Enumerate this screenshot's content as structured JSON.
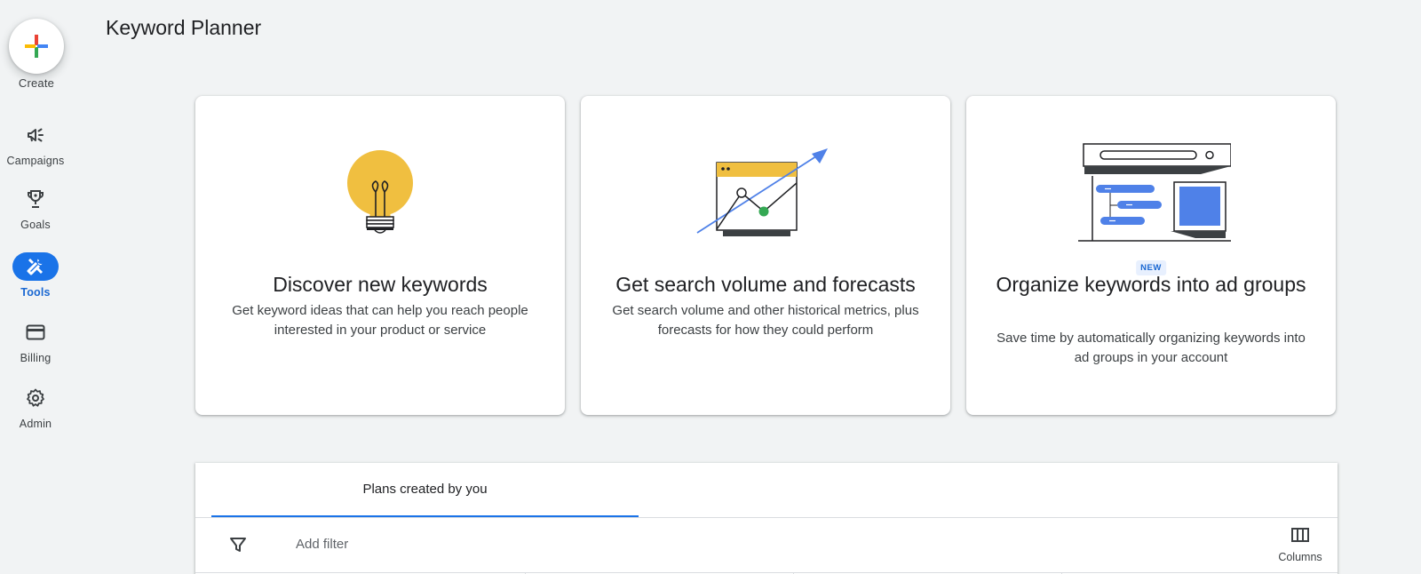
{
  "rail": {
    "create_label": "Create",
    "items": [
      {
        "label": "Campaigns",
        "icon": "megaphone-icon"
      },
      {
        "label": "Goals",
        "icon": "trophy-icon"
      },
      {
        "label": "Tools",
        "icon": "tools-icon",
        "active": true
      },
      {
        "label": "Billing",
        "icon": "credit-card-icon"
      },
      {
        "label": "Admin",
        "icon": "gear-icon"
      }
    ]
  },
  "page": {
    "title": "Keyword Planner"
  },
  "cards": [
    {
      "title": "Discover new keywords",
      "description": "Get keyword ideas that can help you reach people interested in your product or service",
      "illustration": "lightbulb-illustration"
    },
    {
      "title": "Get search volume and forecasts",
      "description": "Get search volume and other historical metrics, plus forecasts for how they could perform",
      "illustration": "chart-trend-illustration"
    },
    {
      "title": "Organize keywords into ad groups",
      "description": "Save time by automatically organizing keywords into ad groups in your account",
      "illustration": "ad-groups-illustration",
      "badge": "NEW"
    }
  ],
  "plans": {
    "tab_label": "Plans created by you",
    "add_filter_label": "Add filter",
    "columns_label": "Columns"
  },
  "colors": {
    "accent": "#1a73e8",
    "yellow": "#f0bf40",
    "blue_illus": "#4f81e8",
    "green": "#34a853"
  }
}
